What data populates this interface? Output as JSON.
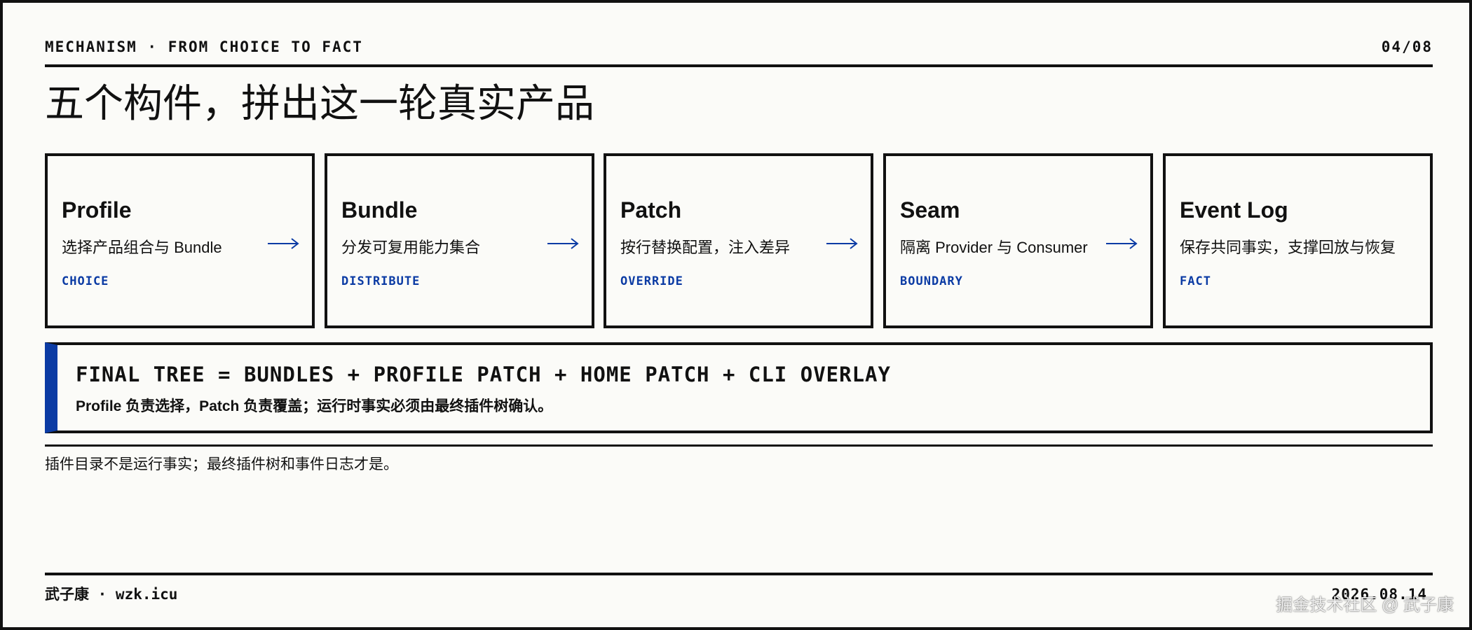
{
  "header": {
    "section": "MECHANISM · FROM CHOICE TO FACT",
    "page": "04/08"
  },
  "title": "五个构件，拼出这一轮真实产品",
  "cards": [
    {
      "name": "Profile",
      "desc": "选择产品组合与 Bundle",
      "tag": "CHOICE",
      "arrow": "right-arrow-icon"
    },
    {
      "name": "Bundle",
      "desc": "分发可复用能力集合",
      "tag": "DISTRIBUTE",
      "arrow": "right-arrow-icon"
    },
    {
      "name": "Patch",
      "desc": "按行替换配置，注入差异",
      "tag": "OVERRIDE",
      "arrow": "right-arrow-icon"
    },
    {
      "name": "Seam",
      "desc": "隔离 Provider 与 Consumer",
      "tag": "BOUNDARY",
      "arrow": "right-arrow-icon"
    },
    {
      "name": "Event Log",
      "desc": "保存共同事实，支撑回放与恢复",
      "tag": "FACT"
    }
  ],
  "formula": {
    "main": "FINAL TREE = BUNDLES + PROFILE PATCH + HOME PATCH + CLI OVERLAY",
    "sub": "Profile 负责选择，Patch 负责覆盖；运行时事实必须由最终插件树确认。"
  },
  "note": "插件目录不是运行事实；最终插件树和事件日志才是。",
  "footer": {
    "author": "武子康 · wzk.icu",
    "date": "2026.08.14"
  },
  "watermark": "掘金技术社区 @ 武子康",
  "colors": {
    "accent": "#0b3ba4",
    "ink": "#111111",
    "paper": "#fbfbf8"
  }
}
